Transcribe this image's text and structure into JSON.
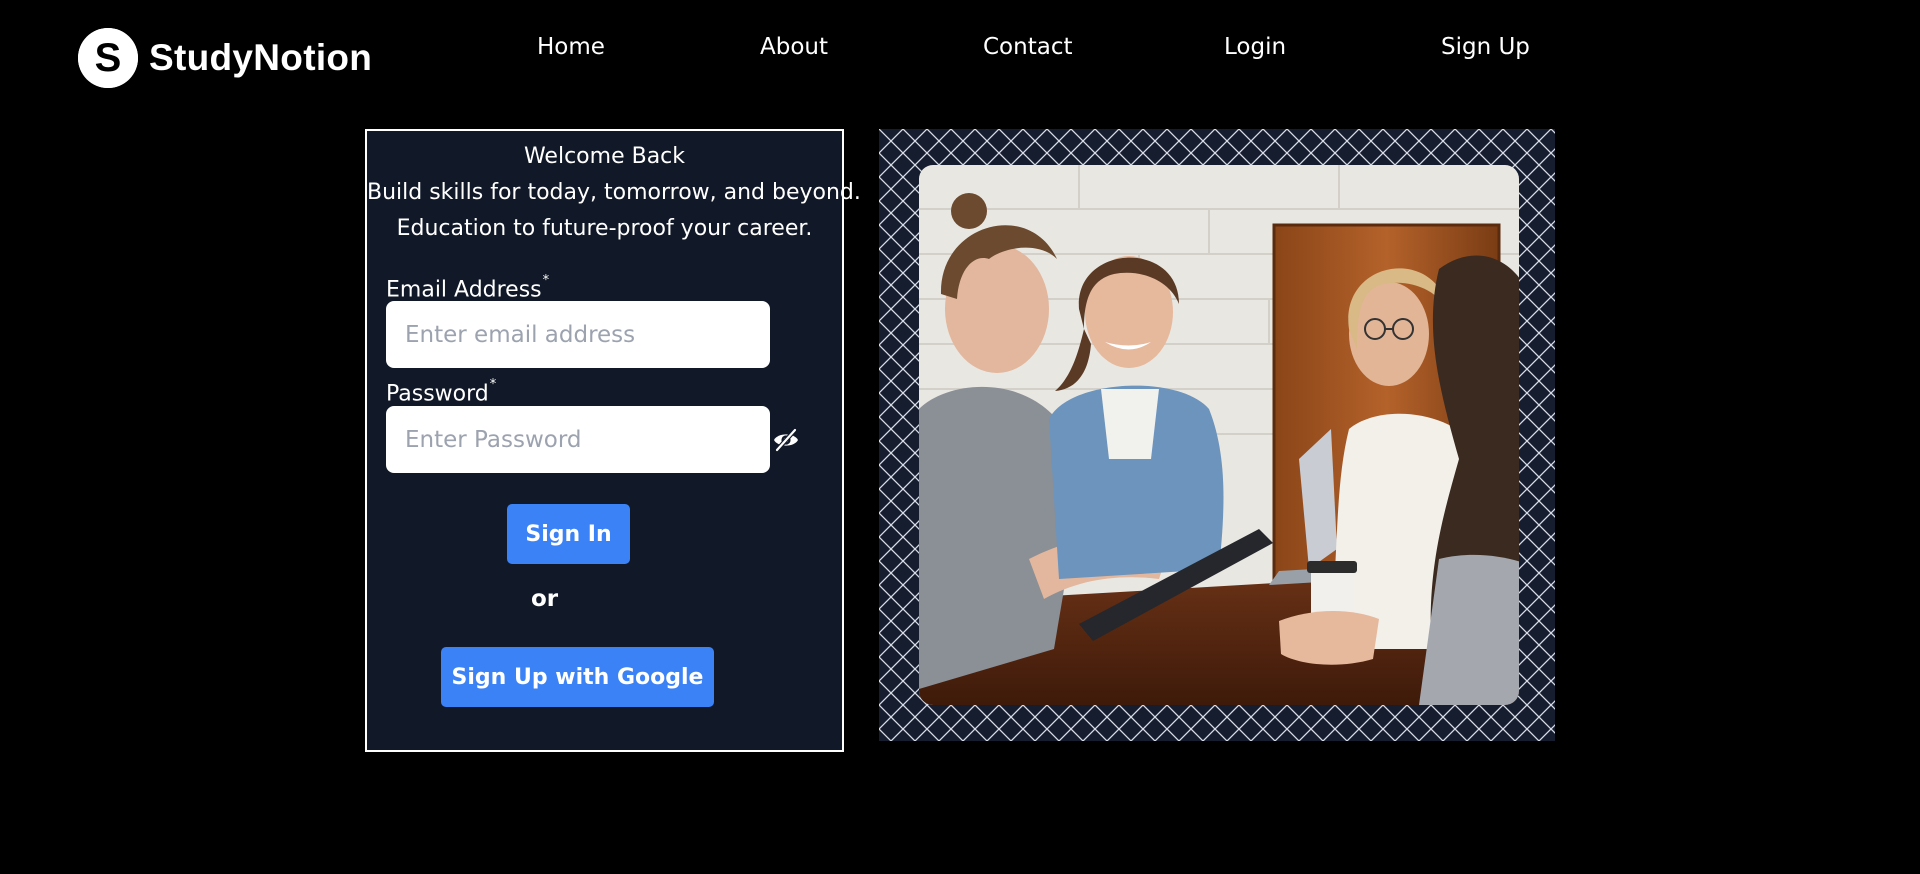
{
  "brand": {
    "name": "StudyNotion",
    "logo_letter": "S",
    "icon": "logo-s-icon"
  },
  "nav": {
    "links": [
      {
        "label": "Home"
      },
      {
        "label": "About"
      },
      {
        "label": "Contact"
      },
      {
        "label": "Login"
      },
      {
        "label": "Sign Up"
      }
    ]
  },
  "login": {
    "heading": "Welcome Back",
    "tagline_1": "Build skills for today, tomorrow, and beyond.",
    "tagline_2": "Education to future-proof your career.",
    "email": {
      "label": "Email Address",
      "required_mark": "*",
      "placeholder": "Enter email address",
      "value": ""
    },
    "password": {
      "label": "Password",
      "required_mark": "*",
      "placeholder": "Enter Password",
      "value": "",
      "toggle_icon": "eye-off-icon"
    },
    "sign_in_label": "Sign In",
    "or_label": "or",
    "google_label": "Sign Up with Google"
  },
  "hero": {
    "image": "students-group-photo",
    "frame_pattern": "diamond-grid"
  },
  "colors": {
    "page_background": "#000000",
    "card_background": "#111827",
    "card_border": "#ffffff",
    "button_primary": "#3b82f6",
    "placeholder_text": "#9ca3af",
    "pattern_background": "#161d2f"
  }
}
